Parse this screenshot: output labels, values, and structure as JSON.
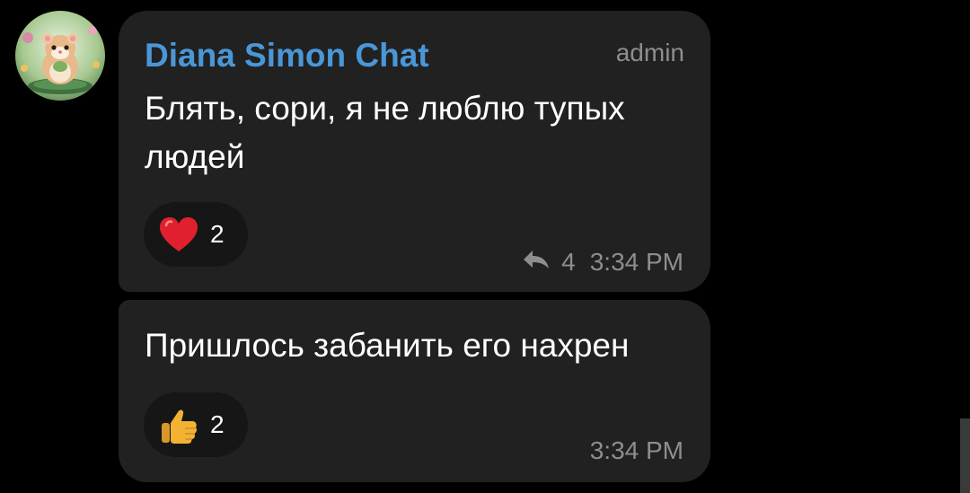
{
  "messages": [
    {
      "sender": "Diana Simon Chat",
      "role": "admin",
      "text": "Блять, сори, я не люблю тупых людей",
      "reaction": {
        "emoji": "red-heart",
        "count": "2"
      },
      "replies": "4",
      "time": "3:34 PM"
    },
    {
      "text": "Пришлось забанить его нахрен",
      "reaction": {
        "emoji": "thumbs-up",
        "count": "2"
      },
      "time": "3:34 PM"
    }
  ],
  "colors": {
    "background": "#000000",
    "bubble": "#212121",
    "sender_name": "#4a97d8",
    "meta_text": "#8e8e8e",
    "heart": "#e0202e",
    "thumb": "#f2b233"
  }
}
